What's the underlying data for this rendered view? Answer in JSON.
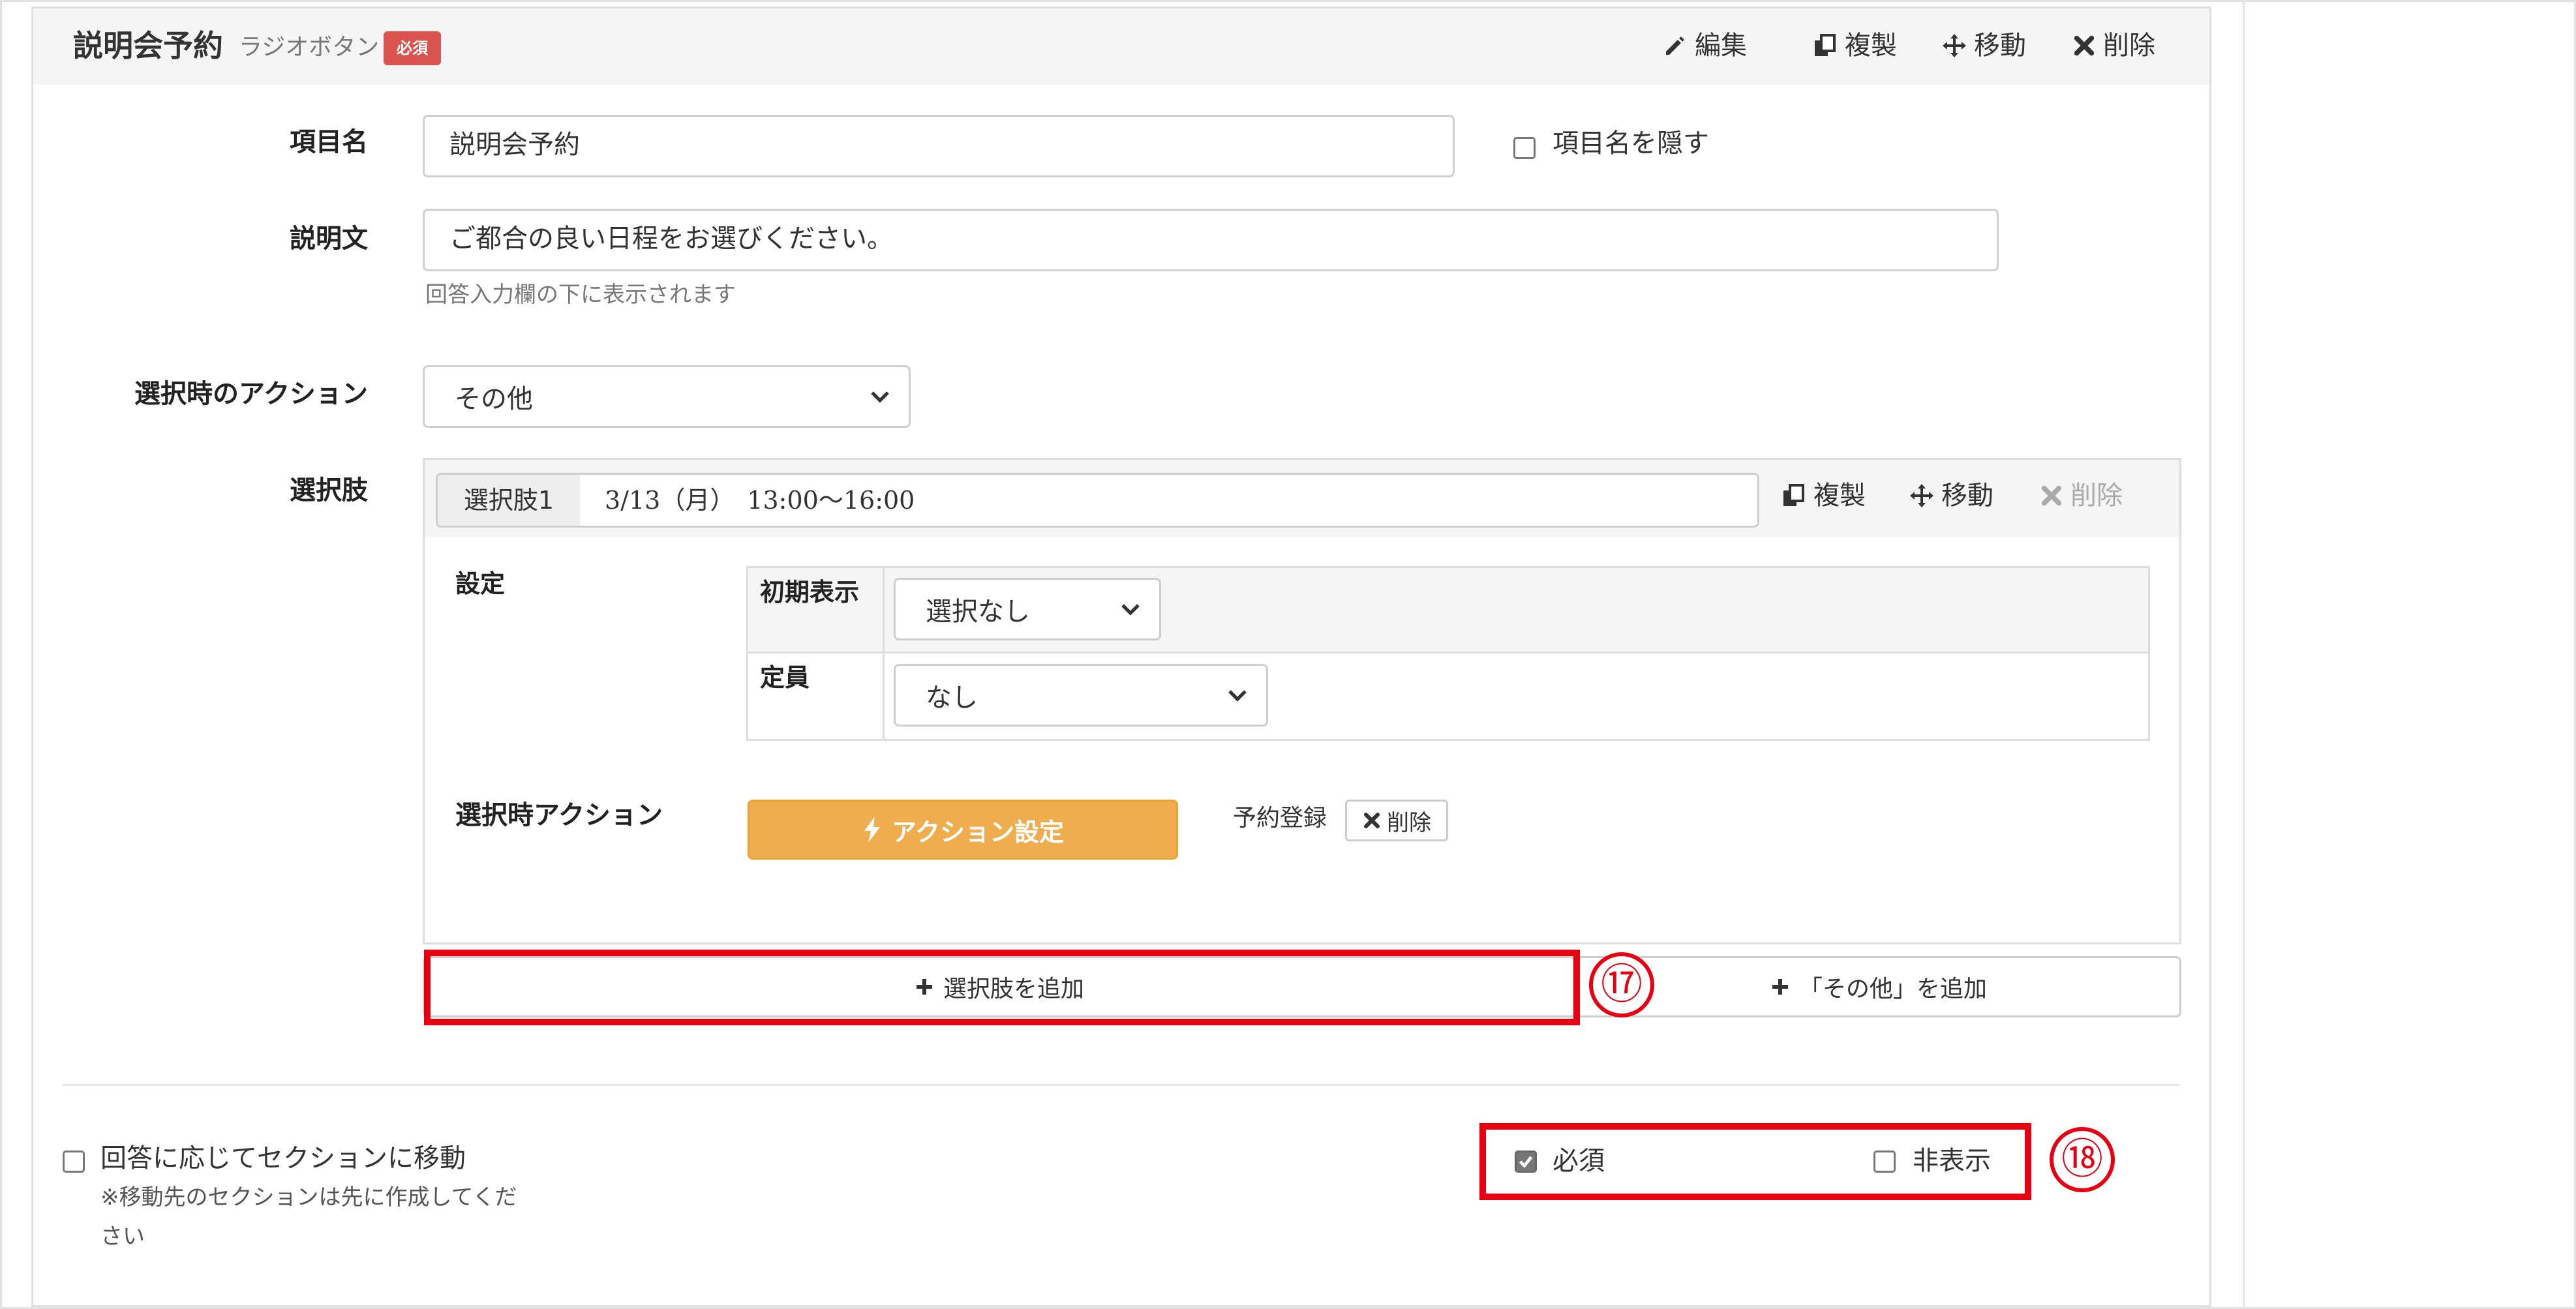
{
  "header": {
    "title": "説明会予約",
    "subtype": "ラジオボタン",
    "required_badge": "必須",
    "actions": {
      "edit": "編集",
      "duplicate": "複製",
      "move": "移動",
      "delete": "削除"
    }
  },
  "item_name": {
    "label": "項目名",
    "value": "説明会予約",
    "hide_label": "項目名を隠す"
  },
  "description": {
    "label": "説明文",
    "value": "ご都合の良い日程をお選びください。",
    "help": "回答入力欄の下に表示されます"
  },
  "select_action": {
    "label": "選択時のアクション",
    "value": "その他"
  },
  "options": {
    "label": "選択肢",
    "item": {
      "addon": "選択肢1",
      "value": "3/13（月）　13:00〜16:00",
      "duplicate": "複製",
      "move": "移動",
      "delete": "削除"
    },
    "settings": {
      "label": "設定",
      "initial_display_label": "初期表示",
      "initial_display_value": "選択なし",
      "capacity_label": "定員",
      "capacity_value": "なし"
    },
    "action": {
      "label": "選択時アクション",
      "button": "アクション設定",
      "registered": "予約登録",
      "delete": "削除"
    },
    "add_option": "選択肢を追加",
    "add_other": "「その他」を追加"
  },
  "footer": {
    "move_section_label": "回答に応じてセクションに移動",
    "move_section_note_line1": "※移動先のセクションは先に作成してくだ",
    "move_section_note_line2": "さい",
    "required_label": "必須",
    "hidden_label": "非表示"
  },
  "annotations": {
    "n17": "⑰",
    "n18": "⑱"
  },
  "colors": {
    "red": "#e60012",
    "orange": "#f0ad4e",
    "badge": "#d9534f"
  }
}
